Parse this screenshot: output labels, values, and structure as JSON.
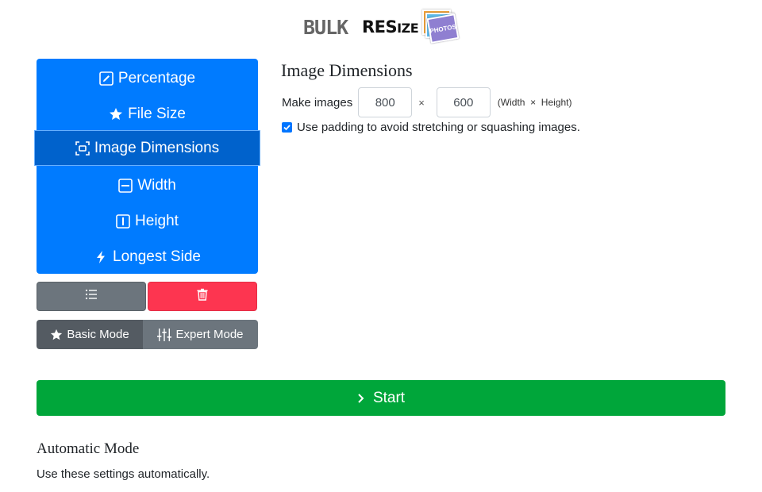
{
  "logo": {
    "bulk": "BULK",
    "resize_big": "RES",
    "resize_small": "IZE",
    "photos": "PHOTOS"
  },
  "menu": {
    "items": [
      {
        "label": "Percentage",
        "icon": "pencil-square-icon"
      },
      {
        "label": "File Size",
        "icon": "star-icon"
      },
      {
        "label": "Image Dimensions",
        "icon": "dimensions-icon",
        "active": true
      },
      {
        "label": "Width",
        "icon": "minus-square-icon"
      },
      {
        "label": "Height",
        "icon": "bar-square-icon"
      },
      {
        "label": "Longest Side",
        "icon": "lightning-icon"
      }
    ]
  },
  "buttons": {
    "list_icon": "list-icon",
    "trash_icon": "trash-icon"
  },
  "modes": {
    "basic": "Basic Mode",
    "expert": "Expert Mode"
  },
  "panel": {
    "title": "Image Dimensions",
    "make_label": "Make images",
    "width": "800",
    "times": "×",
    "height": "600",
    "hint": "(Width  ×  Height)",
    "padding_label": "Use padding to avoid stretching or squashing images.",
    "padding_checked": true
  },
  "start": {
    "label": "Start"
  },
  "auto": {
    "title": "Automatic Mode",
    "desc": "Use these settings automatically."
  },
  "colors": {
    "primary": "#007bff",
    "active": "#0062cc",
    "secondary": "#6c757d",
    "danger": "#fd3550",
    "success": "#00a63a"
  }
}
